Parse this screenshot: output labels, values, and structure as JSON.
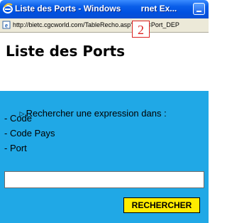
{
  "window": {
    "title": "Liste des Ports - Windows Internet Ex...",
    "title_visible": "Liste des Ports - Windows ",
    "title_visible_tail": "rnet Ex...",
    "icon": "internet-explorer-icon",
    "minimize_icon": "minimize-icon"
  },
  "annotation": {
    "badge_label": "2"
  },
  "addressbar": {
    "icon": "page-icon",
    "url": "http://bietc.cgcworld.com/TableRecho.asp?CAS=Port_DEP"
  },
  "page": {
    "title": "Liste des Ports",
    "search_panel": {
      "intro": "Rechercher une expression dans :",
      "intro_icon": "play-arrow-icon",
      "options": [
        "- Code",
        "- Code Pays",
        "- Port"
      ],
      "input_value": "",
      "input_placeholder": "",
      "button_label": "RECHERCHER"
    }
  },
  "colors": {
    "titlebar": "#0a5ee8",
    "panel": "#20a8e6",
    "button": "#ffec00",
    "badge": "#dd2222"
  }
}
